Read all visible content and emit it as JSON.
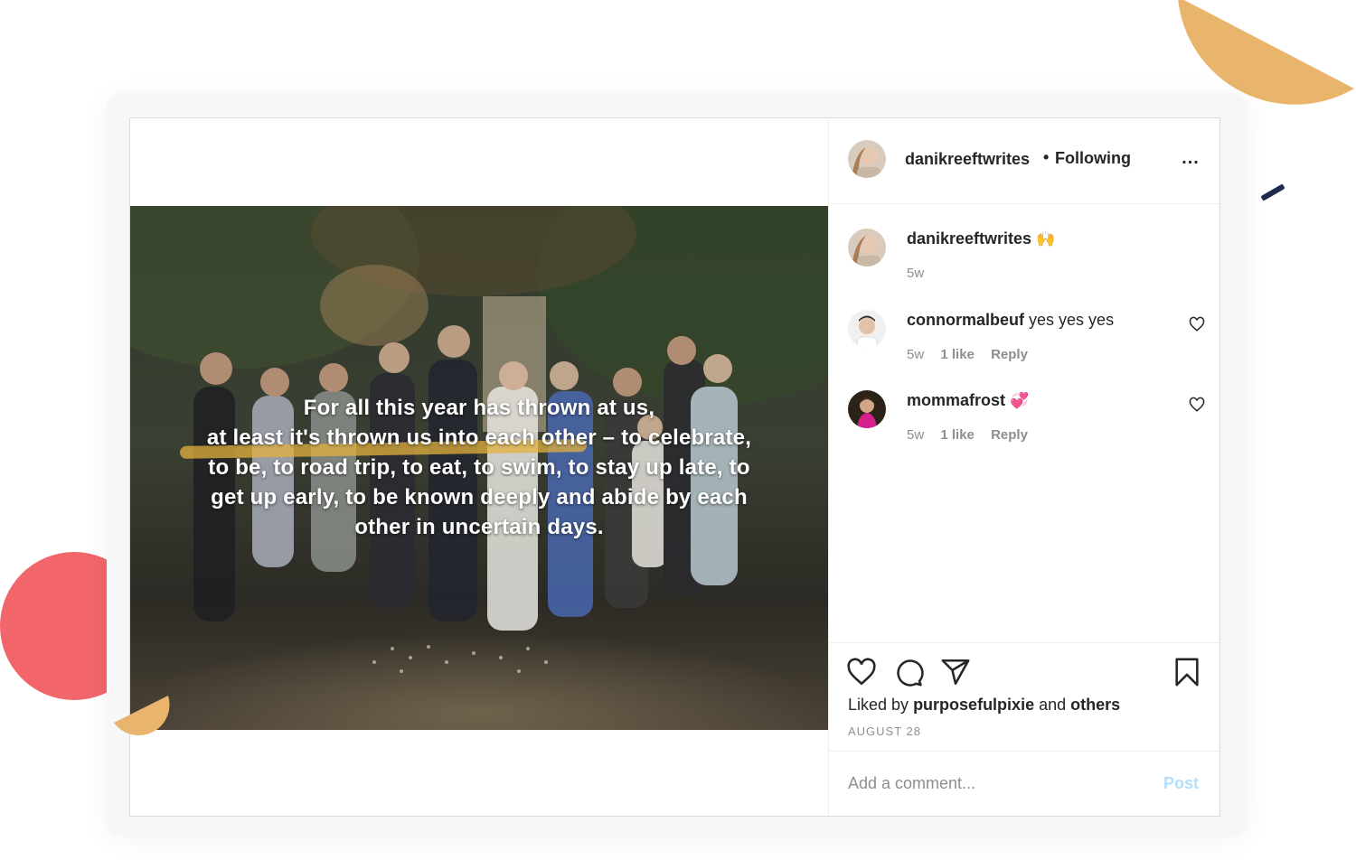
{
  "colors": {
    "accent_orange": "#e9b46b",
    "accent_red": "#f2656a",
    "accent_green": "#4fa877",
    "accent_navy": "#1f2a4d",
    "post_button_disabled": "#b2dffc",
    "text_primary": "#262626",
    "text_secondary": "#8e8e8e"
  },
  "post": {
    "image_caption_lines": [
      "For all this year has thrown at us,",
      "at least it's thrown us into each other – to celebrate,",
      "to be, to road trip, to eat, to swim, to stay up late, to",
      "get up early, to be known deeply and abide by each",
      "other in uncertain days."
    ]
  },
  "header": {
    "username": "danikreeftwrites",
    "separator": "•",
    "follow_status": "Following",
    "more_icon": "more-horizontal-icon",
    "more_label": "..."
  },
  "comments": [
    {
      "username": "danikreeftwrites",
      "text": "",
      "emoji": "🙌",
      "age": "5w",
      "likes": "",
      "reply": ""
    },
    {
      "username": "connormalbeuf",
      "text": "yes yes yes",
      "emoji": "",
      "age": "5w",
      "likes": "1 like",
      "reply": "Reply"
    },
    {
      "username": "mommafrost",
      "text": "",
      "emoji": "💞",
      "age": "5w",
      "likes": "1 like",
      "reply": "Reply"
    }
  ],
  "actions": {
    "like_icon": "heart-icon",
    "comment_icon": "comment-icon",
    "share_icon": "paper-plane-icon",
    "save_icon": "bookmark-icon",
    "liked_by_prefix": "Liked by",
    "liked_by_user": "purposefulpixie",
    "liked_by_and": "and",
    "liked_by_others": "others",
    "date": "AUGUST 28"
  },
  "comment_box": {
    "placeholder": "Add a comment...",
    "post_label": "Post"
  }
}
